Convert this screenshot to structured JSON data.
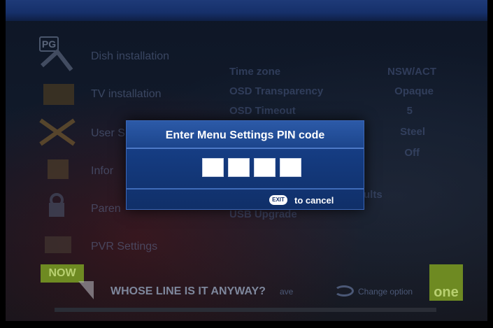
{
  "menu": {
    "rating_badge": "PG",
    "items": [
      {
        "label": "Dish installation",
        "icon": "satellite-dish-icon"
      },
      {
        "label": "TV installation",
        "icon": "tv-icon"
      },
      {
        "label": "User S",
        "icon": "tools-icon"
      },
      {
        "label": "Infor",
        "icon": "info-box-icon"
      },
      {
        "label": "Paren",
        "icon": "parental-lock-icon"
      },
      {
        "label": "PVR Settings",
        "icon": "pvr-icon"
      }
    ]
  },
  "settings": [
    {
      "name": "Time zone",
      "value": "NSW/ACT"
    },
    {
      "name": "OSD Transparency",
      "value": "Opaque"
    },
    {
      "name": "OSD Timeout",
      "value": "5"
    },
    {
      "name": "",
      "value": "Steel"
    },
    {
      "name": "",
      "value": "Off"
    },
    {
      "name": "USB Upgrade",
      "value": ""
    }
  ],
  "settings_fragment": "ults",
  "pin_dialog": {
    "title": "Enter Menu Settings PIN code",
    "digit_count": 4,
    "cancel_key": "EXIT",
    "cancel_label": "to cancel"
  },
  "info_bar": {
    "now_label": "NOW",
    "program_title": "WHOSE LINE IS IT ANYWAY?",
    "save_hint": "ave",
    "change_hint": "Change option",
    "channel_logo": "one"
  },
  "colors": {
    "dialog_bg": "#143a7e",
    "dialog_border": "#3b67b8",
    "now_badge": "#6e8a22"
  }
}
